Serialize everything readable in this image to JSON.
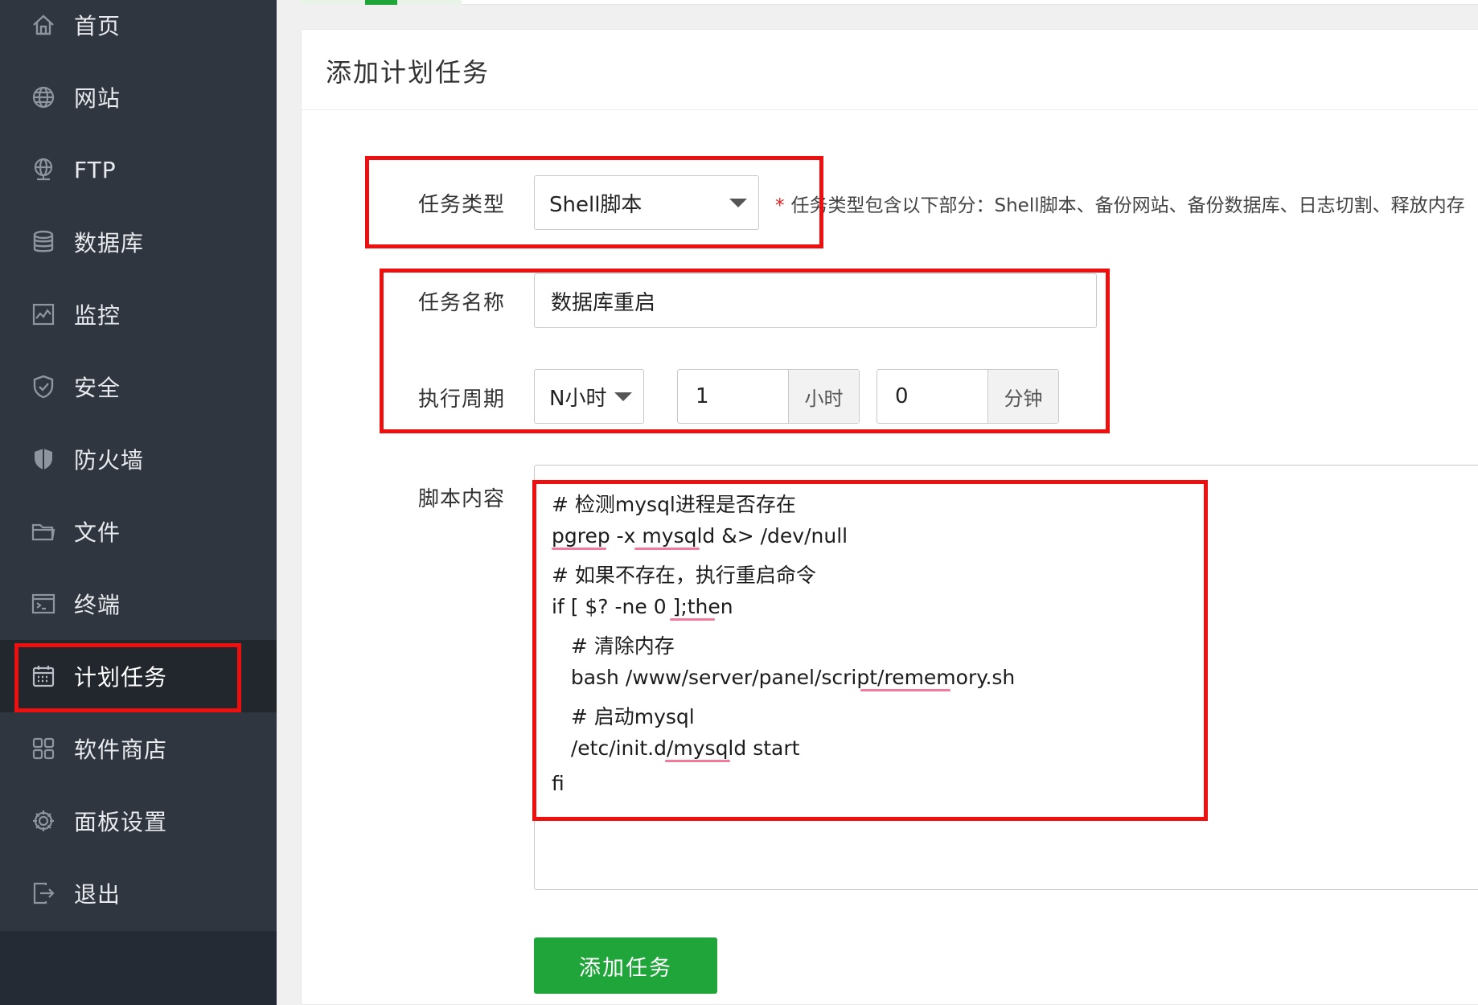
{
  "sidebar": {
    "items": [
      {
        "label": "首页",
        "icon": "home-icon"
      },
      {
        "label": "网站",
        "icon": "globe-icon"
      },
      {
        "label": "FTP",
        "icon": "ftp-icon"
      },
      {
        "label": "数据库",
        "icon": "database-icon"
      },
      {
        "label": "监控",
        "icon": "monitor-icon"
      },
      {
        "label": "安全",
        "icon": "shield-icon"
      },
      {
        "label": "防火墙",
        "icon": "firewall-icon"
      },
      {
        "label": "文件",
        "icon": "folder-icon"
      },
      {
        "label": "终端",
        "icon": "terminal-icon"
      },
      {
        "label": "计划任务",
        "icon": "calendar-icon",
        "active": true
      },
      {
        "label": "软件商店",
        "icon": "apps-grid-icon"
      },
      {
        "label": "面板设置",
        "icon": "gear-icon"
      },
      {
        "label": "退出",
        "icon": "logout-icon"
      }
    ]
  },
  "page": {
    "title": "添加计划任务"
  },
  "form": {
    "task_type": {
      "label": "任务类型",
      "value": "Shell脚本",
      "hint_star": "*",
      "hint": "任务类型包含以下部分：Shell脚本、备份网站、备份数据库、日志切割、释放内存"
    },
    "task_name": {
      "label": "任务名称",
      "value": "数据库重启"
    },
    "period": {
      "label": "执行周期",
      "type_value": "N小时",
      "hours_value": "1",
      "hours_unit": "小时",
      "minutes_value": "0",
      "minutes_unit": "分钟"
    },
    "script": {
      "label": "脚本内容",
      "lines": [
        "# 检测mysql进程是否存在",
        "pgrep -x mysqld &> /dev/null",
        "# 如果不存在，执行重启命令",
        "if [ $? -ne 0 ];then",
        "   # 清除内存",
        "   bash /www/server/panel/script/rememory.sh",
        "   # 启动mysql",
        "   /etc/init.d/mysqld start",
        "fi"
      ]
    },
    "submit_label": "添加任务"
  },
  "colors": {
    "sidebar_bg": "#303640",
    "accent_green": "#20a53a",
    "annotation_red": "#ee0f0f",
    "spellcheck_pink": "#f27a9a"
  }
}
